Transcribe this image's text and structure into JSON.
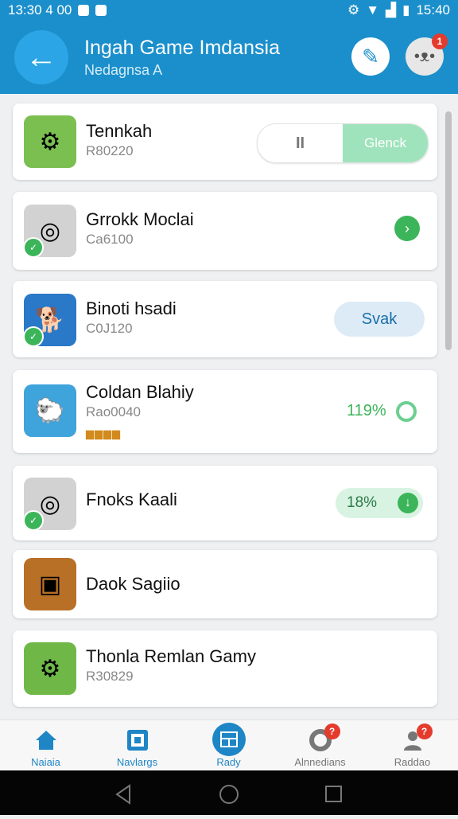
{
  "status": {
    "left_text": "13:30 4 00",
    "right_text": "15:40"
  },
  "header": {
    "title": "Ingah Game Imdansia",
    "subtitle": "Nedagnsa A"
  },
  "items": [
    {
      "name": "Tennkah",
      "sub": "R80220",
      "action": {
        "type": "toggle",
        "left": "II",
        "right": "Glenck"
      }
    },
    {
      "name": "Grrokk Moclai",
      "sub": "Ca6100",
      "action": {
        "type": "arrow"
      }
    },
    {
      "name": "Binoti hsadi",
      "sub": "C0J120",
      "action": {
        "type": "button",
        "label": "Svak"
      }
    },
    {
      "name": "Coldan Blahiy",
      "sub": "Rao0040",
      "action": {
        "type": "progress",
        "label": "119%"
      }
    },
    {
      "name": "Fnoks Kaali",
      "sub": "",
      "action": {
        "type": "download",
        "label": "18%"
      }
    },
    {
      "name": "Daok Sagiio",
      "sub": "",
      "action": {
        "type": "none"
      }
    },
    {
      "name": "Thonla Remlan Gamy",
      "sub": "R30829",
      "action": {
        "type": "none"
      }
    }
  ],
  "bottom_nav": [
    {
      "label": "Naiaia",
      "icon": "home-icon"
    },
    {
      "label": "Navlargs",
      "icon": "grid-icon"
    },
    {
      "label": "Rady",
      "icon": "window-icon",
      "active": true
    },
    {
      "label": "Alnnedians",
      "icon": "ring-icon",
      "badge": "?"
    },
    {
      "label": "Raddao",
      "icon": "person-icon",
      "badge": "?"
    }
  ],
  "badges": {
    "avatar": "1"
  },
  "colors": {
    "accent": "#1b8fcb",
    "green": "#3cb55a",
    "mint": "#9fe3bc",
    "pale_blue": "#ddebf7"
  }
}
